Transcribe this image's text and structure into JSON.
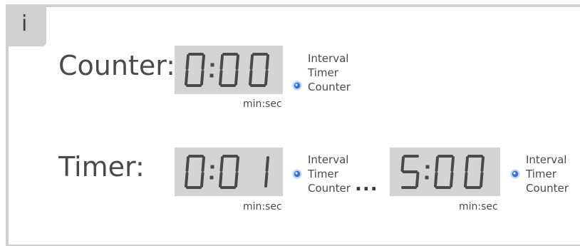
{
  "info_tab": {
    "icon": "info-icon",
    "glyph": "i"
  },
  "counter": {
    "label": "Counter:",
    "display": {
      "digits": "0:00",
      "unit": "min:sec"
    },
    "modes": [
      "Interval",
      "Timer",
      "Counter"
    ],
    "active_mode": "Counter"
  },
  "timer": {
    "label": "Timer:",
    "start_display": {
      "digits": "0:01",
      "unit": "min:sec",
      "modes": [
        "Interval",
        "Timer",
        "Counter"
      ],
      "active_mode": "Timer"
    },
    "ellipsis": "...",
    "end_display": {
      "digits": "5:00",
      "unit": "min:sec",
      "modes": [
        "Interval",
        "Timer",
        "Counter"
      ],
      "active_mode": "Timer"
    }
  },
  "colors": {
    "panel": "#cfcfcf",
    "lcd_bg": "#d4d4d4",
    "segment": "#4a4a4a",
    "indicator": "#2f6fd6"
  }
}
